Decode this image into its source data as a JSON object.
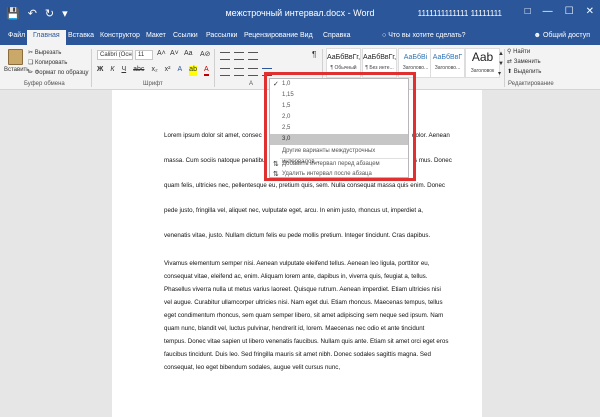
{
  "titlebar": {
    "title": "межстрочный интервал.docx - Word",
    "user": "1111111111111 11111111",
    "qat": [
      "save-icon",
      "undo-icon",
      "redo-icon",
      "customize-icon"
    ],
    "window_buttons": [
      "ribbon-options-icon",
      "minimize-icon",
      "maximize-icon",
      "close-icon"
    ]
  },
  "tabs": [
    "Файл",
    "Главная",
    "Вставка",
    "Конструктор",
    "Макет",
    "Ссылки",
    "Рассылки",
    "Рецензирование",
    "Вид",
    "Справка"
  ],
  "tell_me": "Что вы хотите сделать?",
  "share": "Общий доступ",
  "clipboard": {
    "paste": "Вставить",
    "cut": "Вырезать",
    "copy": "Копировать",
    "format_painter": "Формат по образцу",
    "group": "Буфер обмена"
  },
  "font": {
    "name": "Calibri (Осно",
    "size": "11",
    "group": "Шрифт",
    "buttons": [
      "Ж",
      "К",
      "Ч",
      "abc",
      "x₂",
      "x²"
    ]
  },
  "paragraph_group": "А",
  "styles": [
    {
      "preview": "АаБбВвГг,",
      "name": "¶ Обычный"
    },
    {
      "preview": "АаБбВвГг,",
      "name": "¶ Без инте..."
    },
    {
      "preview": "АаБбВі",
      "name": "Заголово..."
    },
    {
      "preview": "АаБбВвГ",
      "name": "Заголово..."
    },
    {
      "preview": "Aab",
      "name": "Заголовок"
    }
  ],
  "editing": {
    "find": "Найти",
    "replace": "Заменить",
    "select": "Выделить",
    "group": "Редактирование"
  },
  "line_spacing_menu": {
    "items": [
      "1,0",
      "1,15",
      "1,5",
      "2,0",
      "2,5",
      "3,0"
    ],
    "checked": "1,0",
    "highlighted": "3,0",
    "more": "Другие варианты междустрочных интервалов...",
    "add_before": "Добавить интервал перед абзацем",
    "remove_after": "Удалить интервал после абзаца"
  },
  "document": {
    "para1": [
      "Lorem ipsum dolor sit amet, consec",
      "massa. Cum sociis natoque penatibu",
      "quam felis, ultricies nec, pellentesque eu, pretium quis, sem. Nulla consequat massa quis enim. Donec",
      "pede justo, fringilla vel, aliquet nec, vulputate eget, arcu. In enim justo, rhoncus ut, imperdiet a,",
      "venenatis vitae, justo. Nullam dictum felis eu pede mollis pretium. Integer tincidunt. Cras dapibus."
    ],
    "para1_right": [
      "dolor. Aenean",
      "s mus. Donec"
    ],
    "para2": [
      "Vivamus elementum semper nisi. Aenean vulputate eleifend tellus. Aenean leo ligula, porttitor eu,",
      "consequat vitae, eleifend ac, enim. Aliquam lorem ante, dapibus in, viverra quis, feugiat a, tellus.",
      "Phasellus viverra nulla ut metus varius laoreet. Quisque rutrum. Aenean imperdiet. Etiam ultricies nisi",
      "vel augue. Curabitur ullamcorper ultricies nisi. Nam eget dui. Etiam rhoncus. Maecenas tempus, tellus",
      "eget condimentum rhoncus, sem quam semper libero, sit amet adipiscing sem neque sed ipsum. Nam",
      "quam nunc, blandit vel, luctus pulvinar, hendrerit id, lorem. Maecenas nec odio et ante tincidunt",
      "tempus. Donec vitae sapien ut libero venenatis faucibus. Nullam quis ante. Etiam sit amet orci eget eros",
      "faucibus tincidunt. Duis leo. Sed fringilla mauris sit amet nibh. Donec sodales sagittis magna. Sed",
      "consequat, leo eget bibendum sodales, augue velit cursus nunc,"
    ]
  }
}
